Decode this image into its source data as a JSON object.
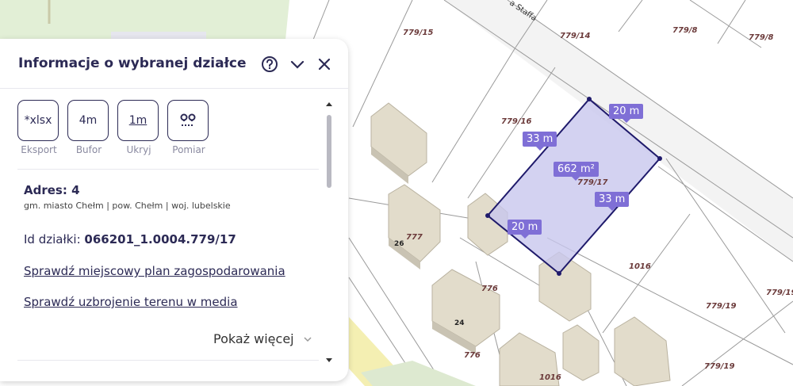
{
  "map": {
    "street_label": "a Staffa",
    "parcels": {
      "p1": "779/15",
      "p2": "779/14",
      "p3": "779/8",
      "p4": "779/8",
      "p5": "779/16",
      "p6": "779/17",
      "p7": "1016",
      "p8": "779/19",
      "p9": "779/19",
      "p10": "779/19",
      "p11": "777",
      "p12": "776",
      "p13": "776",
      "p14": "1016"
    },
    "house_numbers": {
      "h1": "26",
      "h2": "24"
    },
    "dimensions": {
      "top_right": "20 m",
      "top_left": "33 m",
      "right": "33 m",
      "bottom_left": "20 m",
      "area": "662 m²"
    },
    "colors": {
      "parcel_fill": "#c8c7ee",
      "parcel_stroke": "#1f1a6b",
      "tag": "#7f6fd6"
    }
  },
  "panel": {
    "title": "Informacje o wybranej działce",
    "help_icon": "help-circle-icon",
    "collapse_icon": "chevron-down-icon",
    "close_icon": "close-icon",
    "tools": [
      {
        "box": "*xlsx",
        "caption": "Eksport"
      },
      {
        "box": "4m",
        "caption": "Bufor"
      },
      {
        "box": "1m",
        "caption": "Ukryj"
      },
      {
        "box": "",
        "caption": "Pomiar",
        "icon": "measure-pins-icon"
      }
    ],
    "address_title": "Adres: 4",
    "address_sub": "gm. miasto Chełm | pow. Chełm | woj. lubelskie",
    "parcel_id_label": "Id działki: ",
    "parcel_id_value": "066201_1.0004.779/17",
    "link_plan": "Sprawdź miejscowy plan zagospodarowania",
    "link_media": "Sprawdź uzbrojenie terenu w media",
    "show_more": "Pokaż więcej"
  }
}
